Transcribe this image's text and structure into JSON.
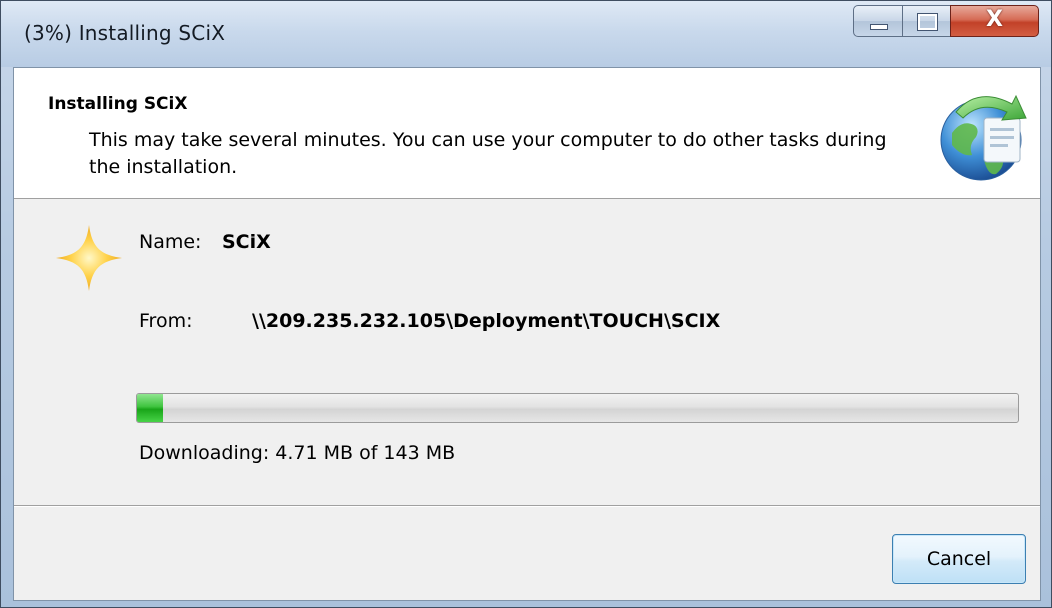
{
  "window": {
    "title": "(3%) Installing SCiX",
    "close_glyph": "X"
  },
  "header": {
    "title": "Installing SCiX",
    "description": "This may take several minutes. You can use your computer to do other tasks during the installation.",
    "icon": "globe-install-icon"
  },
  "details": {
    "name_label": "Name:",
    "name_value": "SCiX",
    "from_label": "From:",
    "from_value": "\\\\209.235.232.105\\Deployment\\TOUCH\\SCIX",
    "icon": "sparkle-star-icon"
  },
  "progress": {
    "percent": 3,
    "status": "Downloading: 4.71 MB of 143 MB"
  },
  "footer": {
    "cancel_label": "Cancel"
  },
  "colors": {
    "progress_green": "#22b022",
    "close_red": "#c74a2f",
    "star_gold": "#f5b324"
  }
}
